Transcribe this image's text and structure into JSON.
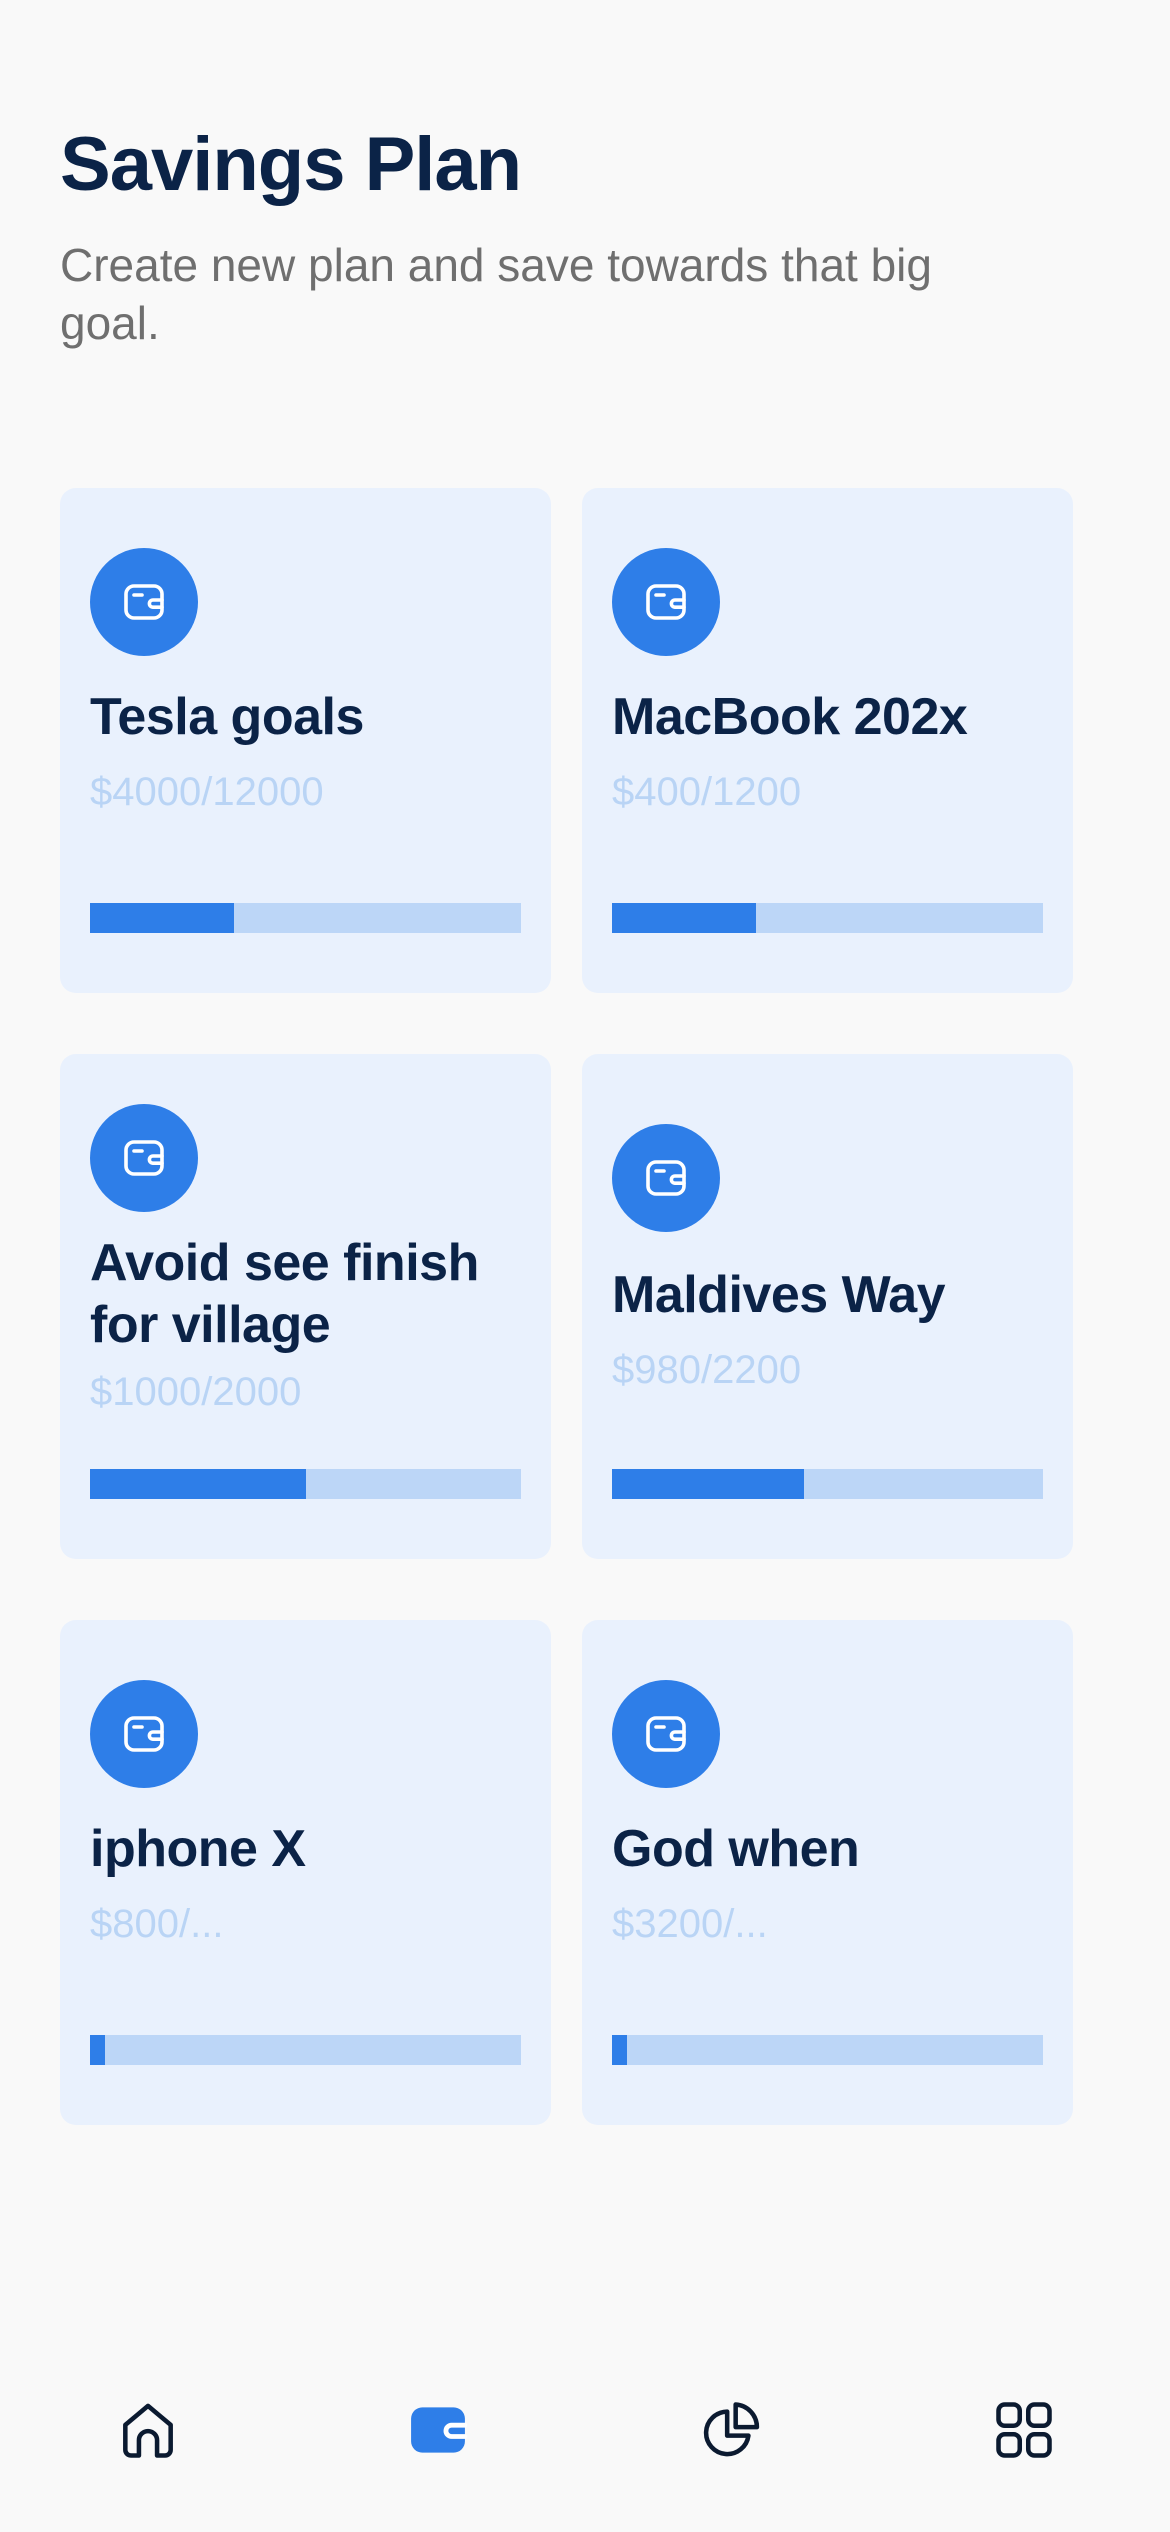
{
  "header": {
    "title": "Savings Plan",
    "subtitle": "Create new plan and save towards that big goal."
  },
  "colors": {
    "accent": "#2e7ee8",
    "card_bg": "#e9f1fd",
    "progress_track": "#bcd6f7",
    "title_text": "#0b2347",
    "amount_text": "#b9d4f5",
    "subtitle_text": "#6f6f6f"
  },
  "plans": [
    {
      "name": "Tesla goals",
      "amount": "$4000/12000",
      "progress": 0.333,
      "icon": "wallet-icon"
    },
    {
      "name": "MacBook 202x",
      "amount": "$400/1200",
      "progress": 0.333,
      "icon": "wallet-icon"
    },
    {
      "name": "Avoid see finish for village",
      "amount": "$1000/2000",
      "progress": 0.5,
      "icon": "wallet-icon"
    },
    {
      "name": "Maldives Way",
      "amount": "$980/2200",
      "progress": 0.445,
      "icon": "wallet-icon"
    },
    {
      "name": "iphone X",
      "amount": "$800/...",
      "progress": 0.035,
      "icon": "wallet-icon"
    },
    {
      "name": "God when",
      "amount": "$3200/...",
      "progress": 0.035,
      "icon": "wallet-icon"
    }
  ],
  "nav": {
    "items": [
      {
        "icon": "home-icon",
        "active": false
      },
      {
        "icon": "wallet-icon",
        "active": true
      },
      {
        "icon": "pie-chart-icon",
        "active": false
      },
      {
        "icon": "grid-icon",
        "active": false
      }
    ]
  }
}
